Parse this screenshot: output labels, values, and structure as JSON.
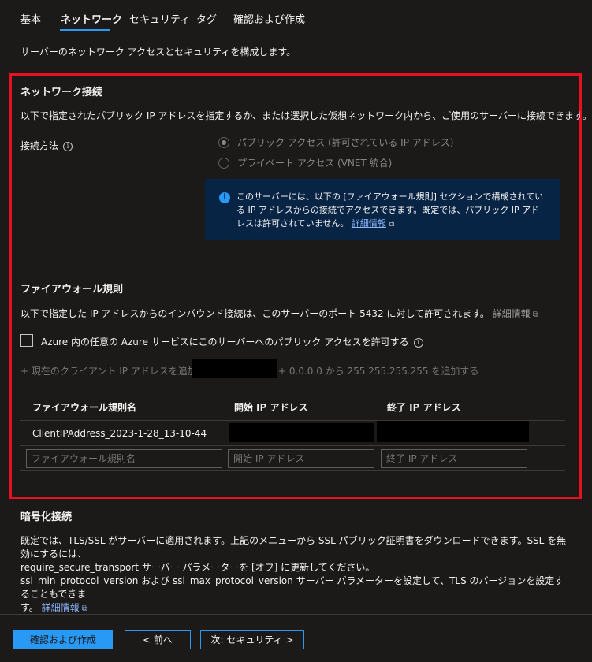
{
  "tabs": [
    "基本",
    "ネットワーク",
    "セキュリティ",
    "タグ",
    "確認および作成"
  ],
  "description": "サーバーのネットワーク アクセスとセキュリティを構成します。",
  "network": {
    "title": "ネットワーク接続",
    "text": "以下で指定されたパブリック IP アドレスを指定するか、または選択した仮想ネットワーク内から、ご使用のサーバーに接続できます。",
    "method_label": "接続方法",
    "options": [
      "パブリック アクセス (許可されている IP アドレス)",
      "プライベート アクセス (VNET 統合)"
    ],
    "info_text": "このサーバーには、以下の [ファイアウォール規則] セクションで構成されている IP アドレスからの接続でアクセスできます。既定では、パブリック IP アドレスは許可されていません。",
    "info_link": "詳細情報"
  },
  "firewall": {
    "title": "ファイアウォール規則",
    "text": "以下で指定した IP アドレスからのインバウンド接続は、このサーバーのポート 5432 に対して許可されます。",
    "link": "詳細情報",
    "checkbox_label": "Azure 内の任意の Azure サービスにこのサーバーへのパブリック アクセスを許可する",
    "add_client": "+ 現在のクライアント IP アドレスを追加する",
    "add_range": "+ 0.0.0.0 から 255.255.255.255 を追加する",
    "columns": [
      "ファイアウォール規則名",
      "開始 IP アドレス",
      "終了 IP アドレス"
    ],
    "row_name": "ClientIPAddress_2023-1-28_13-10-44",
    "placeholders": [
      "ファイアウォール規則名",
      "開始 IP アドレス",
      "終了 IP アドレス"
    ]
  },
  "encryption": {
    "title": "暗号化接続",
    "line1": "既定では、TLS/SSL がサーバーに適用されます。上記のメニューから SSL パブリック証明書をダウンロードできます。SSL を無効にするには、",
    "line2": "require_secure_transport サーバー パラメーターを [オフ] に更新してください。",
    "line3": "ssl_min_protocol_version および ssl_max_protocol_version サーバー パラメーターを設定して、TLS のバージョンを設定することもできま",
    "line4": "す。",
    "link": "詳細情報"
  },
  "buttons": {
    "review": "確認および作成",
    "prev": "< 前へ",
    "next": "次: セキュリティ >"
  },
  "colors": {
    "accent": "#2899f5",
    "highlight": "#e81123",
    "background": "#1b1a19"
  }
}
